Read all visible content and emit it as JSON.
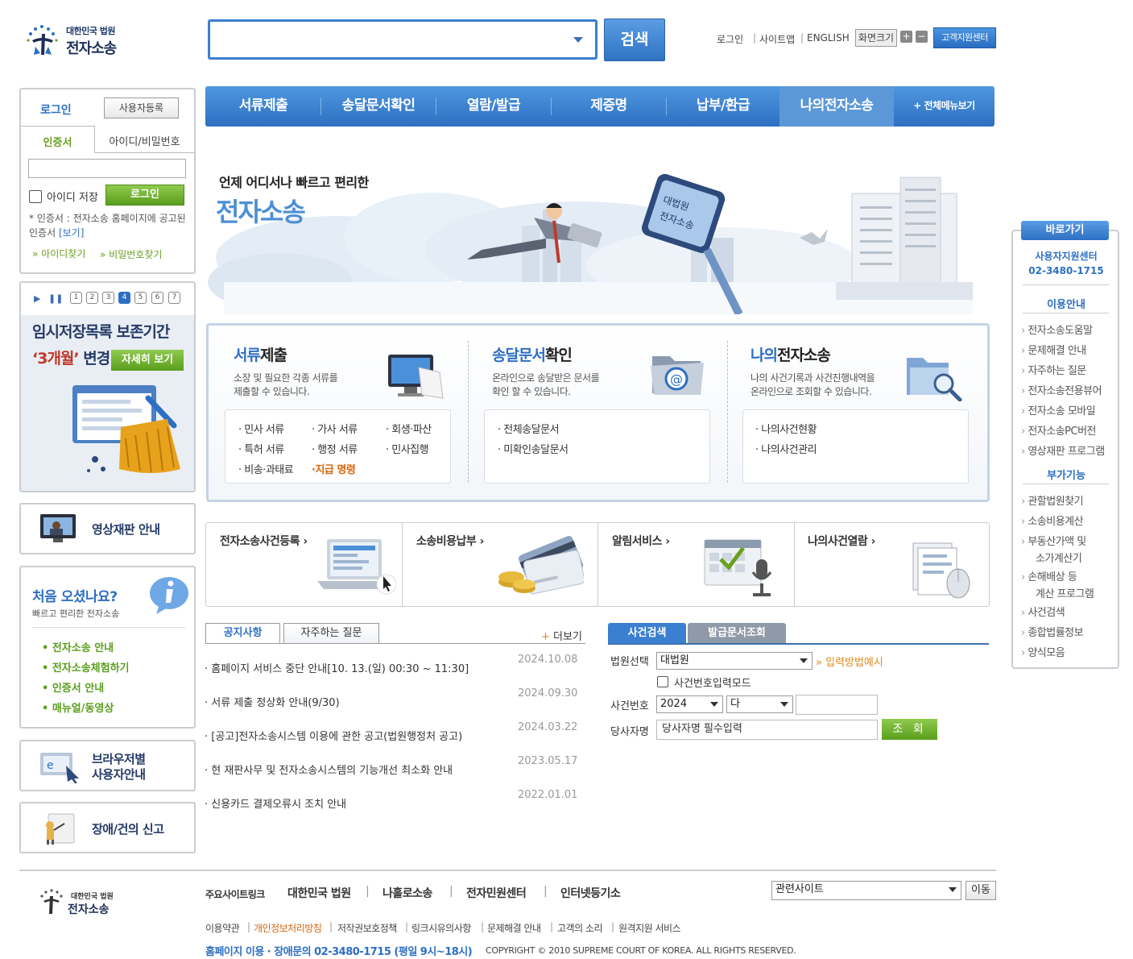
{
  "header": {
    "logo_sub": "대한민국 법원",
    "logo_main": "전자소송",
    "search_button": "검색",
    "util_login": "로그인",
    "util_sitemap": "사이트맵",
    "util_english": "ENGLISH",
    "font_size_label": "화면크기",
    "font_plus": "+",
    "font_minus": "−",
    "help_center": "고객지원센터"
  },
  "gnb": {
    "items": [
      "서류제출",
      "송달문서확인",
      "열람/발급",
      "제증명",
      "납부/환급",
      "나의전자소송"
    ],
    "all_menu": "+ 전체메뉴보기"
  },
  "login": {
    "title": "로그인",
    "register": "사용자등록",
    "tab_cert": "인증서",
    "tab_id": "아이디/비밀번호",
    "save_id": "아이디 저장",
    "login_button": "로그인",
    "note_prefix": "* 인증서 : 전자소송 홈페이지에 공고된 인증서",
    "note_link": "[보기]",
    "find_id": "» 아이디찾기",
    "find_pw": "» 비밀번호찾기"
  },
  "banner": {
    "pages": [
      "1",
      "2",
      "3",
      "4",
      "5",
      "6",
      "7"
    ],
    "line1": "임시저장목록 보존기간",
    "line2_red": "‘3개월’",
    "line2_rest": " 변경",
    "detail": "자세히 보기"
  },
  "side": {
    "video_trial": "영상재판 안내",
    "first_title": "처음 오셨나요?",
    "first_sub": "빠르고 편리한 전자소송",
    "first_items": [
      "• 전자소송 안내",
      "• 전자소송체험하기",
      "• 인증서 안내",
      "• 매뉴얼/동영상"
    ],
    "browser_1": "브라우저별",
    "browser_2": "사용자안내",
    "report": "장애/건의 신고"
  },
  "visual": {
    "tagline": "언제 어디서나 빠르고 편리한",
    "title": "전자소송"
  },
  "services": [
    {
      "title_blue": "서류",
      "title_rest": "제출",
      "desc1": "소장 및 필요한 각종 서류를",
      "desc2": "제출할 수 있습니다.",
      "items": [
        "· 민사 서류",
        "· 가사 서류",
        "· 회생·파산",
        "· 특허 서류",
        "· 행정 서류",
        "· 민사집행",
        "· 비송·과태료",
        "·지급 명령"
      ]
    },
    {
      "title_blue": "송달문서",
      "title_rest": "확인",
      "desc1": "온라인으로 송달받은 문서를",
      "desc2": "확인 할 수 있습니다.",
      "items": [
        "· 전체송달문서",
        "· 미확인송달문서"
      ]
    },
    {
      "title_blue": "나의",
      "title_rest": "전자소송",
      "desc1": "나의 사건기록과 사건진행내역을",
      "desc2": "온라인으로 조회할 수 있습니다.",
      "items": [
        "· 나의사건현황",
        "· 나의사건관리"
      ]
    }
  ],
  "quick": [
    "전자소송사건등록 ›",
    "소송비용납부 ›",
    "알림서비스 ›",
    "나의사건열람 ›"
  ],
  "notice": {
    "tab_notice": "공지사항",
    "tab_faq": "자주하는 질문",
    "more": "더보기",
    "more_plus": "+ ",
    "items": [
      {
        "title": "· 홈페이지 서비스 중단 안내[10. 13.(일) 00:30 ~ 11:30]",
        "date": "2024.10.08"
      },
      {
        "title": "· 서류 제출 정상화 안내(9/30)",
        "date": "2024.09.30"
      },
      {
        "title": "· [공고]전자소송시스템 이용에 관한 공고(법원행정처 공고)",
        "date": "2024.03.22"
      },
      {
        "title": "· 현 재판사무 및 전자소송시스템의 기능개선 최소화 안내",
        "date": "2023.05.17"
      },
      {
        "title": "· 신용카드 결제오류시 조치 안내",
        "date": "2022.01.01"
      }
    ]
  },
  "case_search": {
    "tab_case": "사건검색",
    "tab_issue": "발급문서조회",
    "court_label": "법원선택",
    "court_value": "대법원",
    "input_example": "» 입력방법예시",
    "mode_label": "사건번호입력모드",
    "case_no_label": "사건번호",
    "year_value": "2024",
    "type_value": "다",
    "party_label": "당사자명",
    "party_placeholder": "당사자명 필수입력",
    "search_button": "조 회"
  },
  "right_quick": {
    "title": "바로가기",
    "center": "사용자지원센터",
    "tel": "02-3480-1715",
    "guide_title": "이용안내",
    "guide_items": [
      "전자소송도움말",
      "문제해결 안내",
      "자주하는 질문",
      "전자소송전용뷰어",
      "전자소송 모바일",
      "전자소송PC버전",
      "영상재판 프로그램"
    ],
    "extra_title": "부가기능",
    "extra_items": [
      "관할법원찾기",
      "소송비용계산",
      "부동산가액 및",
      "소가계산기",
      "손해배상 등",
      "계산 프로그램",
      "사건검색",
      "종합법률정보",
      "양식모음"
    ]
  },
  "footer": {
    "logo_sub": "대한민국 법원",
    "logo_main": "전자소송",
    "links_label": "주요사이트링크",
    "links": [
      "대한민국 법원",
      "나홀로소송",
      "전자민원센터",
      "인터넷등기소"
    ],
    "related": "관련사이트",
    "go": "이동",
    "bottom": [
      "이용약관",
      "개인정보처리방침",
      "저작권보호정책",
      "링크시유의사항",
      "문제해결 안내",
      "고객의 소리",
      "원격지원 서비스"
    ],
    "tel": "홈페이지 이용 · 장애문의 02-3480-1715 (평일 9시~18시)",
    "copyright": "COPYRIGHT © 2010 SUPREME COURT OF KOREA. ALL RIGHTS RESERVED."
  },
  "colors": {
    "brand_blue": "#2d6fc2",
    "green": "#5a9e1d",
    "orange": "#d9660c"
  }
}
